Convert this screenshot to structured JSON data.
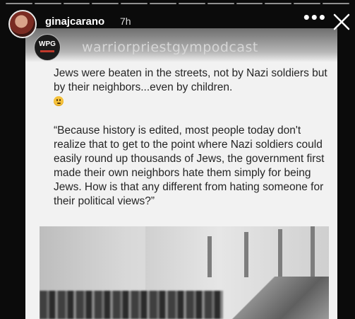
{
  "story": {
    "username": "ginajcarano",
    "time_ago": "7h",
    "more_glyph": "•••",
    "close_icon": "close-icon",
    "progress_segments": 12
  },
  "post": {
    "logo_text": "WPG",
    "handle": "warriorpriestgympodcast",
    "paragraph1": "Jews were beaten in the streets, not by Nazi soldiers but by their neighbors...even by children.",
    "emoji": "frowning-face-icon",
    "paragraph2": "“Because history is edited, most people today don't realize that to get to the point where Nazi soldiers could easily round up thousands of Jews, the government first made their own neighbors hate them simply for being Jews. How is that any different from hating someone for their political views?”"
  },
  "colors": {
    "background": "#0b0b0b",
    "card": "#f2f2f2",
    "text": "#252525"
  }
}
